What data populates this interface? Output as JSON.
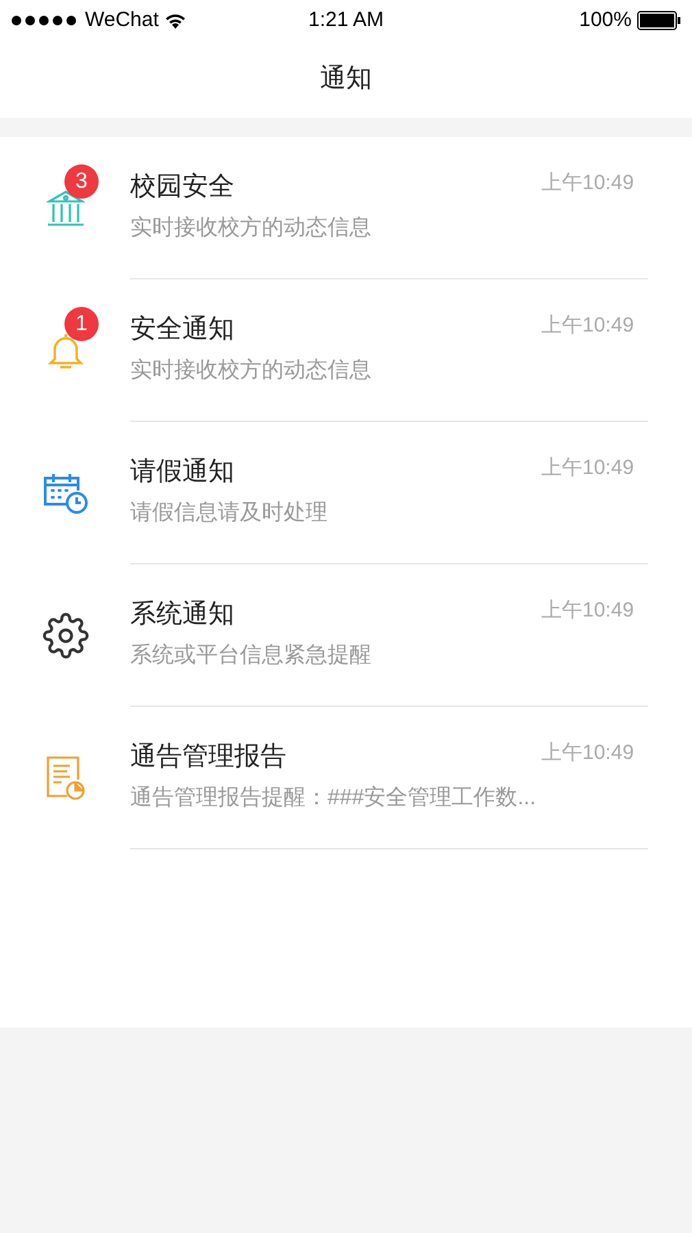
{
  "status_bar": {
    "carrier": "WeChat",
    "time": "1:21 AM",
    "battery": "100%"
  },
  "nav": {
    "title": "通知"
  },
  "items": [
    {
      "kind": "bank",
      "badge": "3",
      "title": "校园安全",
      "subtitle": "实时接收校方的动态信息",
      "time": "上午10:49"
    },
    {
      "kind": "bell",
      "badge": "1",
      "title": "安全通知",
      "subtitle": "实时接收校方的动态信息",
      "time": "上午10:49"
    },
    {
      "kind": "calendar",
      "title": "请假通知",
      "subtitle": "请假信息请及时处理",
      "time": "上午10:49"
    },
    {
      "kind": "gear",
      "title": "系统通知",
      "subtitle": "系统或平台信息紧急提醒",
      "time": "上午10:49"
    },
    {
      "kind": "report",
      "title": "通告管理报告",
      "subtitle": "通告管理报告提醒：###安全管理工作数...",
      "time": "上午10:49"
    }
  ]
}
